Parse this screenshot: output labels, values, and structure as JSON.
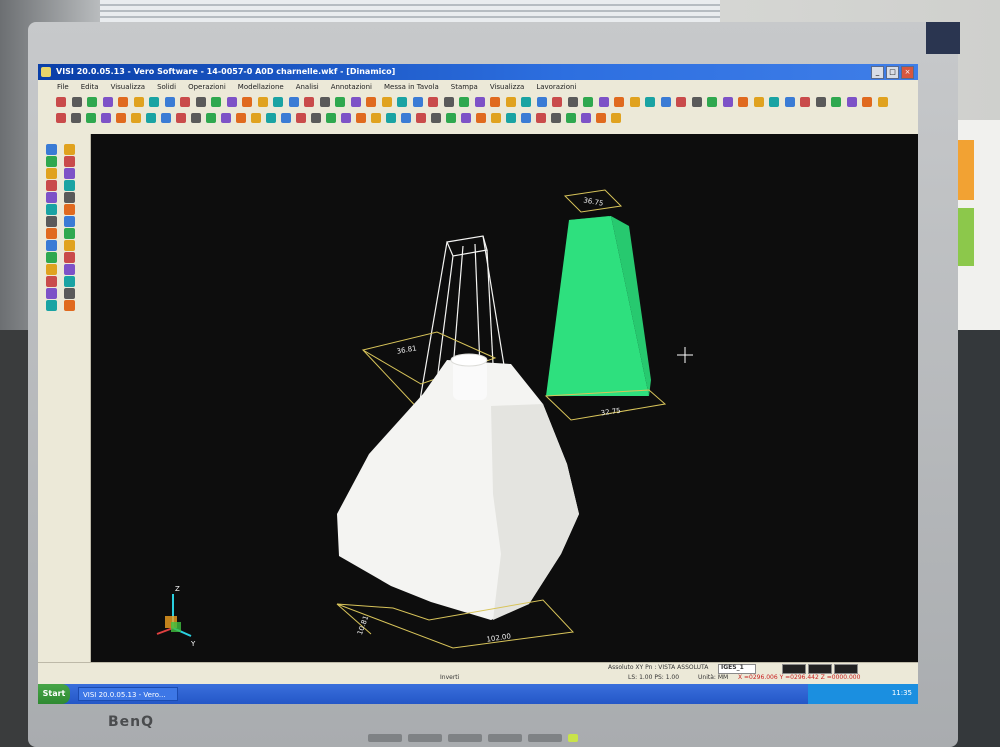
{
  "window": {
    "title": "VISI 20.0.05.13 - Vero Software - 14-0057-0 A0D charnelle.wkf - [Dinamico]",
    "controls": [
      "_",
      "□",
      "×"
    ]
  },
  "menu": {
    "items": [
      "File",
      "Edita",
      "Visualizza",
      "Solidi",
      "Operazioni",
      "Modellazione",
      "Analisi",
      "Annotazioni",
      "Messa in Tavola",
      "Stampa",
      "Visualizza",
      "Lavorazioni"
    ]
  },
  "viewport": {
    "background": "#0d0d0d",
    "solid_color": "#2ee07e",
    "part_color": "#f4f4f2",
    "dimension_color": "#d8c45a",
    "dim_top_green": "36.75",
    "dim_bottom_green": "32.75",
    "dim_top_white": "36.81",
    "dim_bottom_white": "102.00",
    "dim_side_white": "10.81",
    "axis_label_z": "Z",
    "axis_label_y": "Y"
  },
  "status": {
    "mode": "Inverti",
    "coords_label": "Assoluto XY Pn : VISTA ASSOLUTA",
    "layer": "IGES_1",
    "ls_ps": "LS: 1.00 PS: 1.00",
    "units": "Unità: MM",
    "xy": "X =0296.006 Y =0296.442 Z =0000.000"
  },
  "taskbar": {
    "start": "Start",
    "task": "VISI 20.0.05.13 - Vero...",
    "clock": "11:35"
  },
  "monitor": {
    "brand": "BenQ"
  }
}
